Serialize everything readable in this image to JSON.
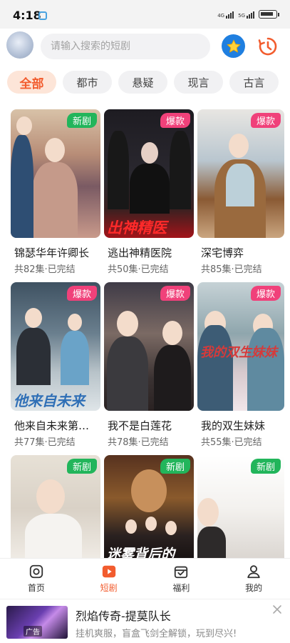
{
  "status_bar": {
    "time": "4:18",
    "signal1_label": "4G",
    "signal2_label": "5G"
  },
  "search": {
    "placeholder": "请输入搜索的短剧"
  },
  "header": {
    "favorites_icon": "star-icon",
    "history_icon": "clock-icon",
    "avatar_icon": "avatar-icon"
  },
  "colors": {
    "accent": "#f25c2e",
    "new_badge": "#22b55b",
    "hot_badge": "#f0417a",
    "favorite_button": "#1f7fe0"
  },
  "tabs": [
    {
      "label": "全部",
      "active": true
    },
    {
      "label": "都市",
      "active": false
    },
    {
      "label": "悬疑",
      "active": false
    },
    {
      "label": "现言",
      "active": false
    },
    {
      "label": "古言",
      "active": false
    }
  ],
  "dramas": [
    {
      "title": "锦瑟华年许卿长",
      "meta": "共82集·已完结",
      "badge": "新剧"
    },
    {
      "title": "逃出神精医院",
      "meta": "共50集·已完结",
      "badge": "爆款",
      "poster_text": "出神精医"
    },
    {
      "title": "深宅博弈",
      "meta": "共85集·已完结",
      "badge": "爆款"
    },
    {
      "title": "他来自未来第…",
      "meta": "共77集·已完结",
      "badge": "爆款",
      "poster_text": "他来自未来"
    },
    {
      "title": "我不是白莲花",
      "meta": "共78集·已完结",
      "badge": "爆款"
    },
    {
      "title": "我的双生妹妹",
      "meta": "共55集·已完结",
      "badge": "爆款",
      "poster_text": "我的双生妹妹"
    },
    {
      "badge": "新剧"
    },
    {
      "badge": "新剧",
      "poster_text": "迷雾背后的"
    },
    {
      "badge": "新剧"
    }
  ],
  "bottom_nav": [
    {
      "label": "首页",
      "icon": "home-icon",
      "active": false
    },
    {
      "label": "短剧",
      "icon": "play-icon",
      "active": true
    },
    {
      "label": "福利",
      "icon": "gift-icon",
      "active": false
    },
    {
      "label": "我的",
      "icon": "user-icon",
      "active": false
    }
  ],
  "ad": {
    "title": "烈焰传奇-提莫队长",
    "desc": "挂机爽服，盲盒飞剑全解锁，玩到尽兴!",
    "tag": "广告"
  }
}
